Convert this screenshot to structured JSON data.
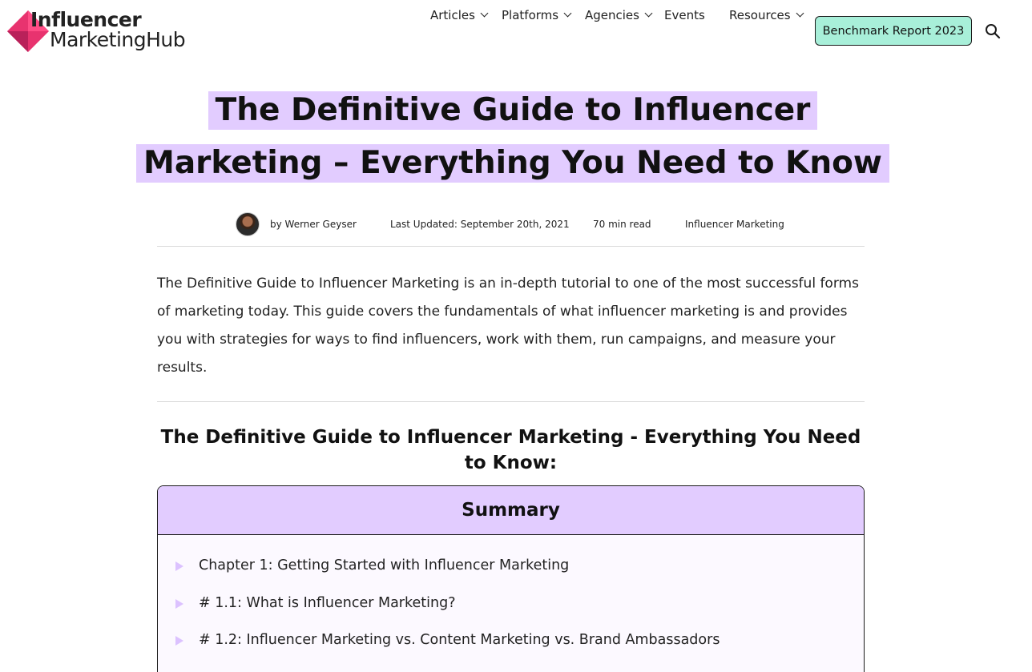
{
  "logo": {
    "line1": "Influencer",
    "line2": "MarketingHub"
  },
  "nav": {
    "items": [
      {
        "label": "Articles",
        "dropdown": true
      },
      {
        "label": "Platforms",
        "dropdown": true
      },
      {
        "label": "Agencies",
        "dropdown": true
      },
      {
        "label": "Events",
        "dropdown": false
      },
      {
        "label": "Resources",
        "dropdown": true
      }
    ],
    "cta_label": "Benchmark Report 2023",
    "search_icon": "search-icon"
  },
  "article": {
    "title_line1": "The Definitive Guide to Influencer",
    "title_line2": "Marketing – Everything You Need to Know",
    "author": "by Werner Geyser",
    "updated": "Last Updated: September 20th, 2021",
    "read_time": "70 min read",
    "category": "Influencer Marketing",
    "intro": "The Definitive Guide to Influencer Marketing is an in-depth tutorial to one of the most successful forms of marketing today. This guide covers the fundamentals of what influencer marketing is and provides you with strategies for ways to find influencers, work with them, run campaigns, and measure your results.",
    "section_heading": "The Definitive Guide to Influencer Marketing - Everything You Need to Know:"
  },
  "summary": {
    "heading": "Summary",
    "items": [
      "Chapter 1: Getting Started with Influencer Marketing",
      "# 1.1: What is Influencer Marketing?",
      "# 1.2: Influencer Marketing vs. Content Marketing vs. Brand Ambassadors"
    ]
  },
  "colors": {
    "highlight": "#e2ccff",
    "cta_background": "#a8efd9",
    "logo_pink": "#e8336f",
    "bullet": "#dcc2ff"
  }
}
